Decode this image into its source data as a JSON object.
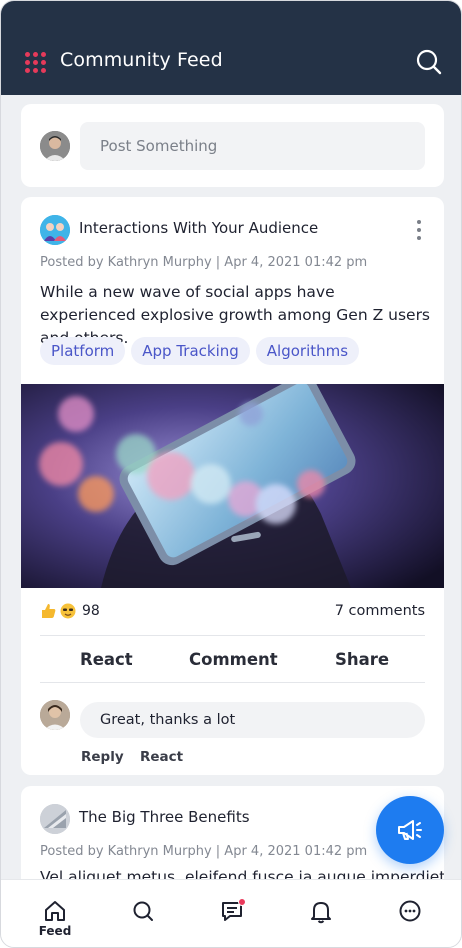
{
  "header": {
    "title": "Community Feed",
    "menu_icon": "grid-dots-icon",
    "search_icon": "search-icon"
  },
  "composer": {
    "placeholder": "Post Something"
  },
  "posts": [
    {
      "title": "Interactions With Your Audience",
      "meta": "Posted by Kathryn Murphy | Apr 4, 2021 01:42 pm",
      "text": "While a new wave of social apps have experienced explosive growth among Gen Z users and others.",
      "tags": [
        "Platform",
        "App Tracking",
        "Algorithms"
      ],
      "reaction_count": "98",
      "comments_label": "7 comments",
      "actions": {
        "react": "React",
        "comment": "Comment",
        "share": "Share"
      },
      "comment": {
        "text": "Great, thanks a lot",
        "reply_label": "Reply",
        "react_label": "React"
      }
    },
    {
      "title": "The Big Three Benefits",
      "meta": "Posted by Kathryn Murphy | Apr 4, 2021 01:42 pm",
      "text": "Vel aliquet metus, eleifend fusce ia augue imperdiet"
    }
  ],
  "nav": {
    "feed_label": "Feed"
  },
  "colors": {
    "header_bg": "#243246",
    "accent": "#1e7cf0",
    "tag_text": "#4a56c8",
    "badge": "#ea3a5c"
  }
}
